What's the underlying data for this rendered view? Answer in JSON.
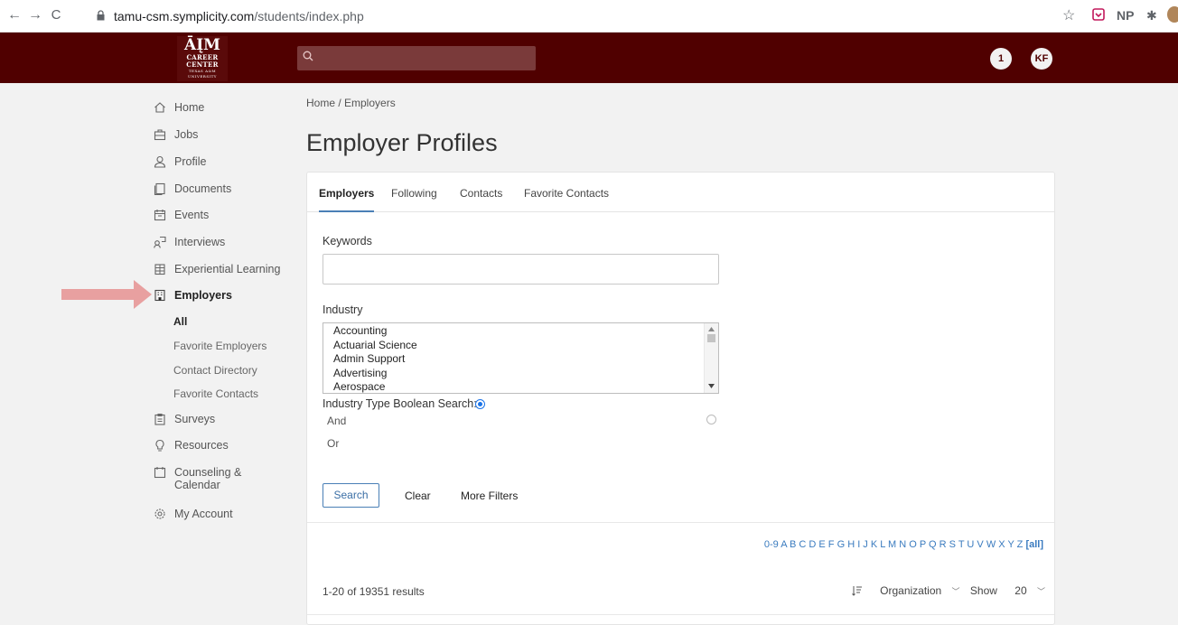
{
  "browser": {
    "url_domain": "tamu-csm.symplicity.com",
    "url_path": "/students/index.php",
    "back_glyph": "←",
    "forward_glyph": "→",
    "reload_glyph": "C",
    "star_glyph": "☆",
    "ext_np": "NP",
    "puzzle_glyph": "✱"
  },
  "header": {
    "logo_mark": "ĀĮM",
    "logo_line1": "CAREER",
    "logo_line2": "CENTER",
    "logo_line3": "TEXAS A&M UNIVERSITY",
    "search_placeholder": "",
    "notification_count": "1",
    "user_initials": "KF",
    "brand_color": "#500000"
  },
  "sidebar": {
    "items": [
      {
        "label": "Home",
        "icon": "home-icon"
      },
      {
        "label": "Jobs",
        "icon": "briefcase-icon"
      },
      {
        "label": "Profile",
        "icon": "person-icon"
      },
      {
        "label": "Documents",
        "icon": "document-icon"
      },
      {
        "label": "Events",
        "icon": "calendar-icon"
      },
      {
        "label": "Interviews",
        "icon": "interviews-icon"
      },
      {
        "label": "Experiential Learning",
        "icon": "building-icon"
      },
      {
        "label": "Employers",
        "icon": "office-icon"
      },
      {
        "label": "Surveys",
        "icon": "clipboard-icon"
      },
      {
        "label": "Resources",
        "icon": "lightbulb-icon"
      },
      {
        "label": "Counseling &",
        "label2": "Calendar",
        "icon": "calendar-outline-icon"
      },
      {
        "label": "My Account",
        "icon": "gear-icon"
      }
    ],
    "employer_sub": [
      "All",
      "Favorite Employers",
      "Contact Directory",
      "Favorite Contacts"
    ]
  },
  "main": {
    "breadcrumb": "Home / Employers",
    "title": "Employer Profiles",
    "tabs": [
      "Employers",
      "Following",
      "Contacts",
      "Favorite Contacts"
    ],
    "keywords_label": "Keywords",
    "keywords_value": "",
    "industry_label": "Industry",
    "industry_options": [
      "Accounting",
      "Actuarial Science",
      "Admin Support",
      "Advertising",
      "Aerospace"
    ],
    "boolean_label": "Industry Type Boolean Search:",
    "boolean_and": "And",
    "boolean_or": "Or",
    "search_button": "Search",
    "clear_button": "Clear",
    "more_filters_button": "More Filters",
    "alpha_index": "0-9 A B C D E F G H I J K L M N O P Q R S T U V W X Y Z",
    "alpha_all": "[all]",
    "results_text": "1-20 of 19351 results",
    "sort_label": "Organization",
    "show_label": "Show",
    "show_count": "20"
  }
}
